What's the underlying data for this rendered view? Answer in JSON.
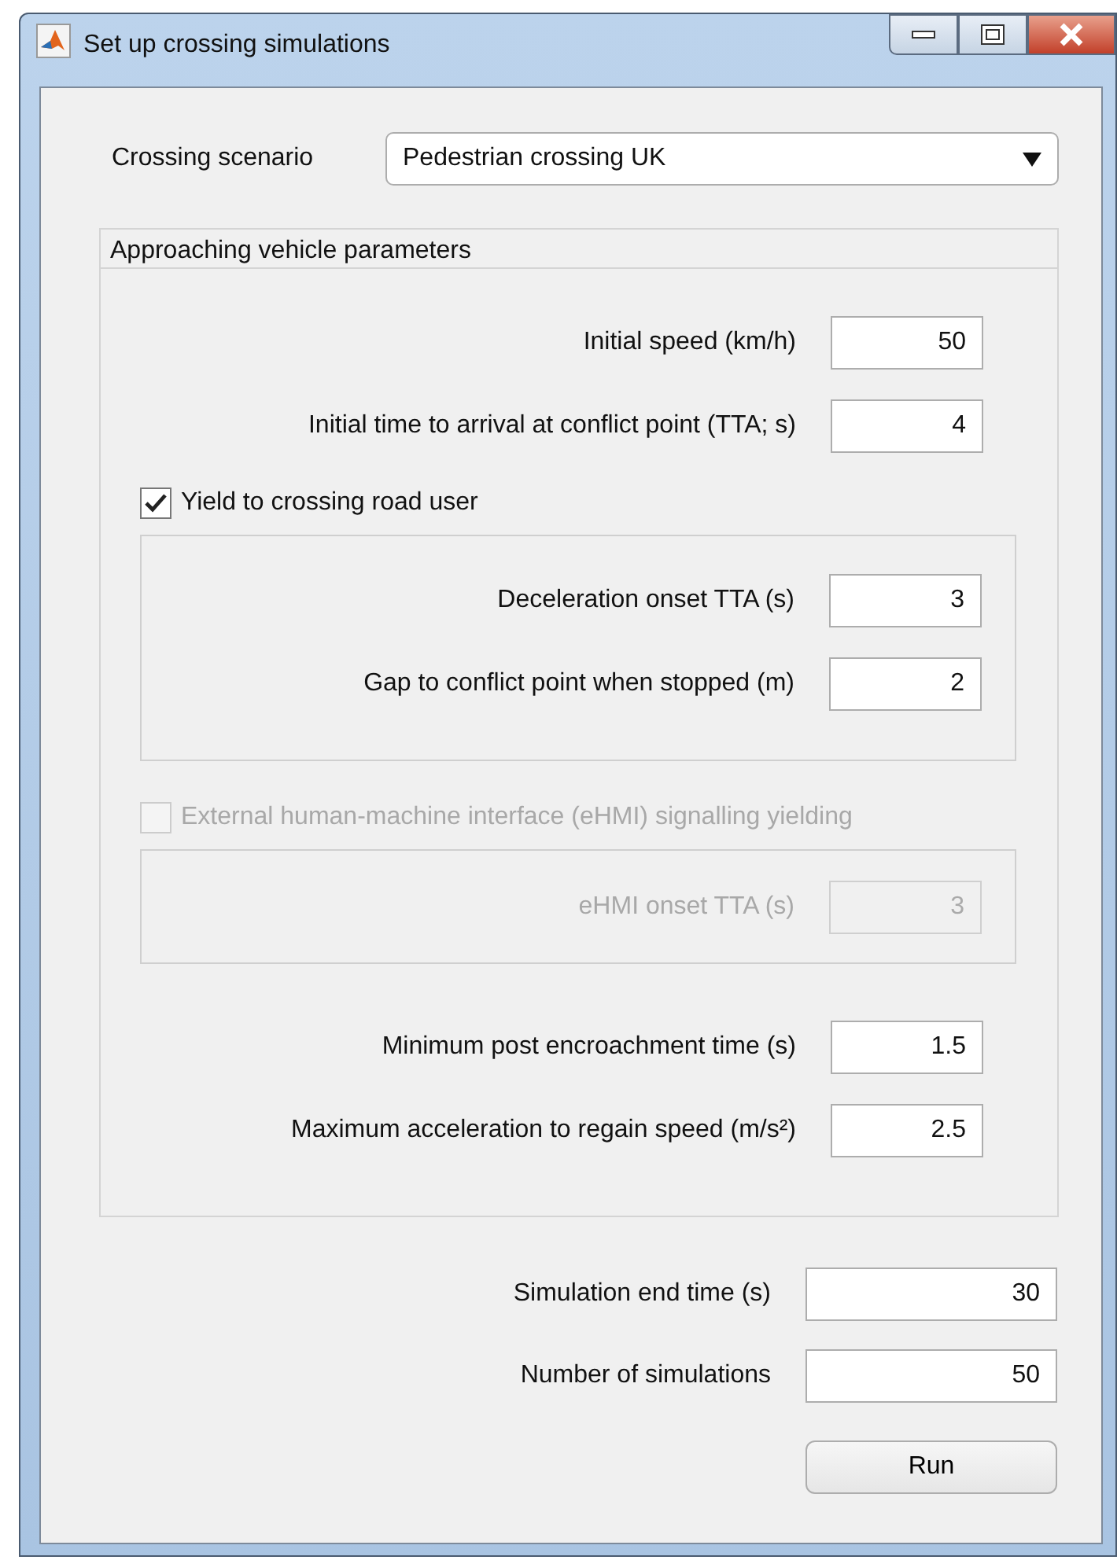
{
  "window": {
    "title": "Set up crossing simulations"
  },
  "scenario": {
    "label": "Crossing scenario",
    "value": "Pedestrian crossing UK"
  },
  "vehicle_panel": {
    "title": "Approaching vehicle parameters",
    "fields": [
      {
        "label": "Initial speed (km/h)",
        "value": "50"
      },
      {
        "label": "Initial time to arrival at conflict point (TTA; s)",
        "value": "4"
      }
    ],
    "groups": [
      {
        "label": "Yield to crossing road user",
        "checked": true,
        "disabled": false,
        "fields": [
          {
            "label": "Deceleration onset TTA (s)",
            "value": "3"
          },
          {
            "label": "Gap to conflict point when stopped (m)",
            "value": "2"
          }
        ]
      },
      {
        "label": "External human-machine interface (eHMI) signalling yielding",
        "checked": false,
        "disabled": true,
        "fields": [
          {
            "label": "eHMI onset TTA (s)",
            "value": "3"
          }
        ]
      }
    ],
    "post_fields": [
      {
        "label": "Minimum post encroachment time (s)",
        "value": "1.5"
      },
      {
        "label": "Maximum acceleration to regain speed (m/s²)",
        "value": "2.5"
      }
    ]
  },
  "fields": [
    {
      "label": "Simulation end time (s)",
      "value": "30"
    },
    {
      "label": "Number of simulations",
      "value": "50"
    }
  ],
  "run_button": {
    "label": "Run"
  }
}
